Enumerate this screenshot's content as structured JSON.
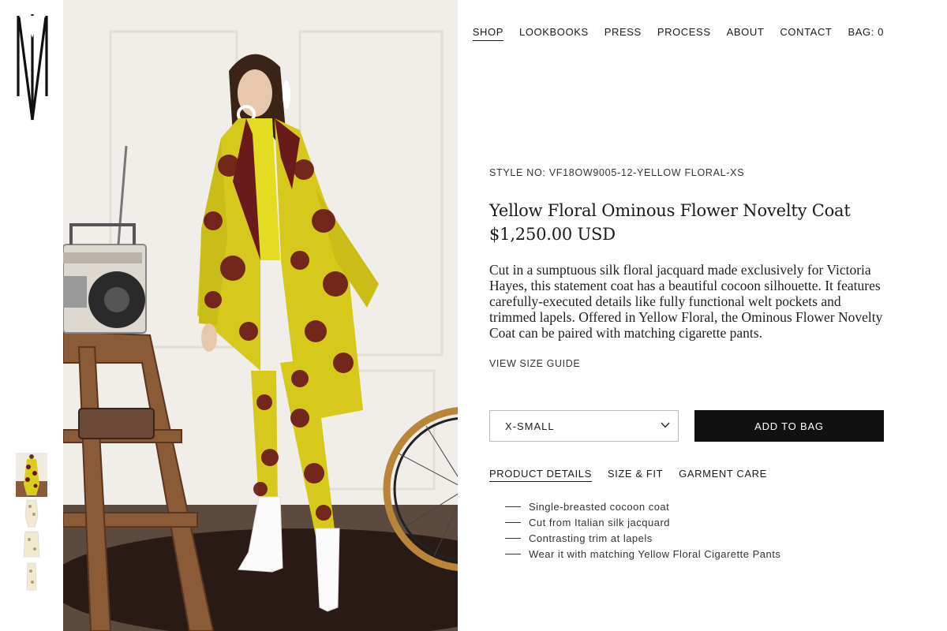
{
  "nav": {
    "items": [
      {
        "label": "SHOP",
        "current": true
      },
      {
        "label": "LOOKBOOKS"
      },
      {
        "label": "PRESS"
      },
      {
        "label": "PROCESS"
      },
      {
        "label": "ABOUT"
      },
      {
        "label": "CONTACT"
      },
      {
        "label": "BAG: 0"
      }
    ]
  },
  "product": {
    "style_no": "STYLE NO: VF18OW9005-12-YELLOW FLORAL-XS",
    "title": "Yellow Floral Ominous Flower Novelty Coat",
    "price": "$1,250.00 USD",
    "description": "Cut in a sumptuous silk floral jacquard made exclusively for Victoria Hayes, this statement coat has a beautiful cocoon silhouette. It features carefully-executed details like fully functional welt pockets and trimmed lapels. Offered in Yellow Floral, the Ominous Flower Novelty Coat can be paired with matching cigarette pants.",
    "size_guide_label": "VIEW SIZE GUIDE",
    "selected_size": "X-SMALL",
    "add_to_bag_label": "ADD TO BAG"
  },
  "tabs": [
    {
      "label": "PRODUCT DETAILS",
      "current": true
    },
    {
      "label": "SIZE & FIT"
    },
    {
      "label": "GARMENT CARE"
    }
  ],
  "details": [
    "Single-breasted cocoon coat",
    "Cut from Italian silk jacquard",
    "Contrasting trim at lapels",
    "Wear it with matching Yellow Floral Cigarette Pants"
  ],
  "icons": {
    "logo": "brand-monogram",
    "dropdown": "chevron-down-icon"
  },
  "colors": {
    "text": "#1a1a1a",
    "button_bg": "#111111",
    "button_text": "#ffffff",
    "coat_yellow": "#e3d51c",
    "coat_floral": "#6b1a1c"
  }
}
